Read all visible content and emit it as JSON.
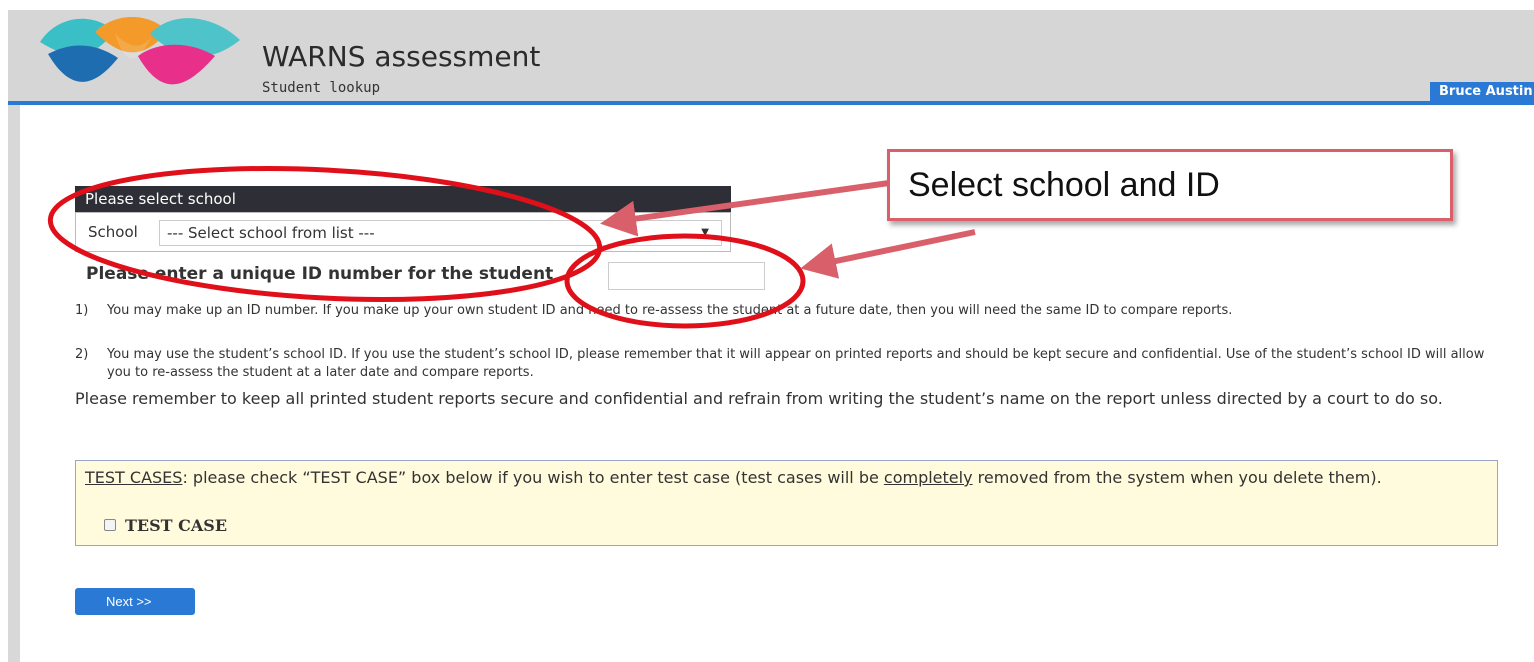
{
  "header": {
    "title": "WARNS assessment",
    "subtitle": "Student lookup",
    "user": "Bruce Austin"
  },
  "school_panel": {
    "header": "Please select school",
    "school_label": "School",
    "school_select_value": "--- Select school from list ---"
  },
  "id_prompt": {
    "label": "Please enter a unique ID number for the student",
    "input_value": ""
  },
  "notes": [
    {
      "num": "1)",
      "text": "You may make up an ID number. If you make up your own student ID and need to re-assess the student at a future date, then you will need the same ID to compare reports."
    },
    {
      "num": "2)",
      "text": "You may use the student’s school ID. If you use the student’s school ID, please remember that it will appear on printed reports and should be kept secure and confidential. Use of the student’s school ID will allow you to re-assess the student at a later date and compare reports."
    }
  ],
  "reminder": "Please remember to keep all printed student reports secure and confidential and refrain from writing the student’s name on the report unless directed by a court to do so.",
  "test_cases": {
    "lead": "TEST CASES",
    "text_before": ": please check “TEST CASE” box below if you wish to enter test case (test cases will be ",
    "emphasis": "completely",
    "text_after": " removed from the system when you delete them).",
    "checkbox_label": "TEST CASE",
    "checked": false
  },
  "next_button": "Next >>",
  "annotation": {
    "callout_text": "Select school and ID",
    "color": "#e0101a",
    "arrow_color": "#d9606b"
  },
  "colors": {
    "accent": "#2a7ad5",
    "header_bg": "#d6d6d6",
    "panel_header_bg": "#2e2e36",
    "test_box_bg": "#fffbdc"
  }
}
